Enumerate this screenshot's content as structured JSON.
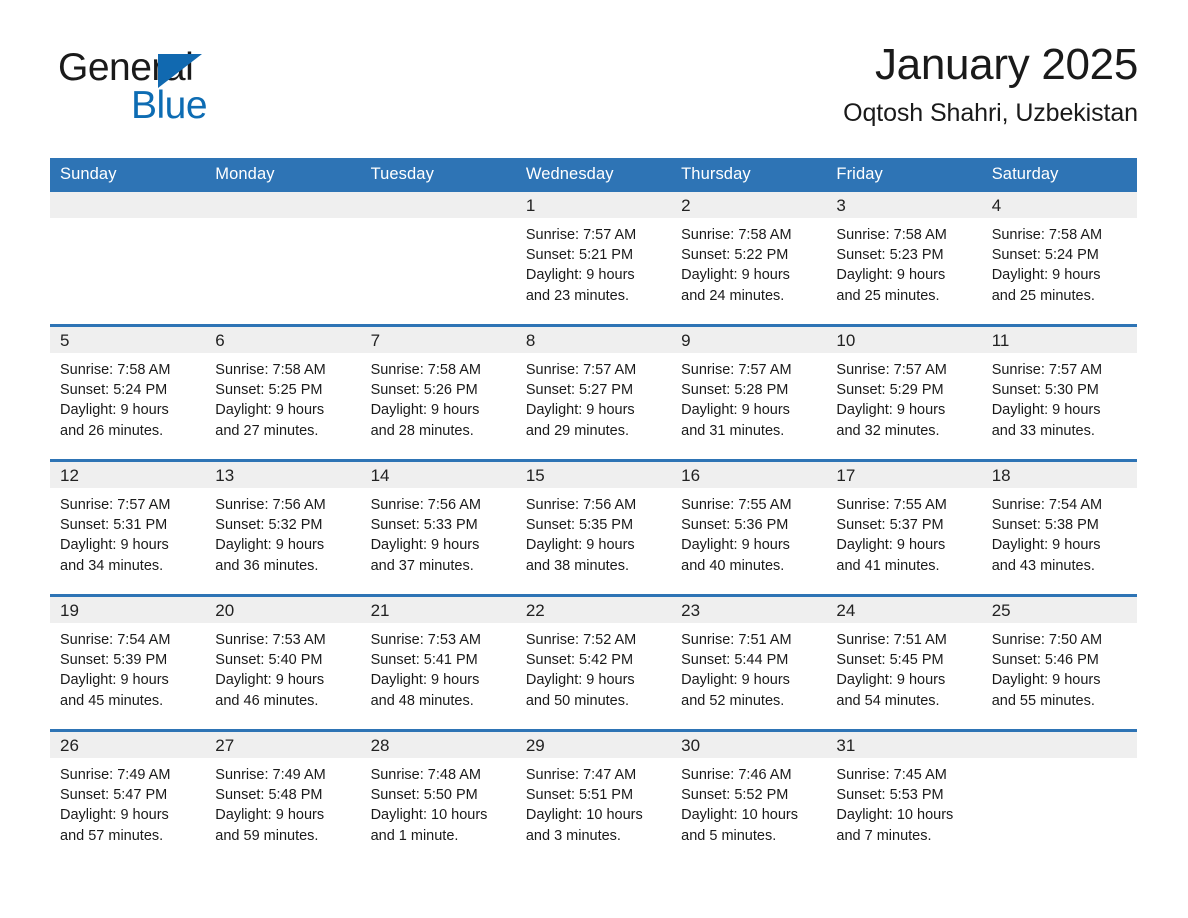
{
  "brand": {
    "name_part1": "General",
    "name_part2": "Blue",
    "triangle_color": "#1169b0",
    "blue_color": "#0d6cb3"
  },
  "header": {
    "title": "January 2025",
    "subtitle": "Oqtosh Shahri, Uzbekistan"
  },
  "theme": {
    "header_blue": "#2e74b5",
    "daynum_band_gray": "#efefef",
    "text_color": "#1a1a1a"
  },
  "weekdays": [
    "Sunday",
    "Monday",
    "Tuesday",
    "Wednesday",
    "Thursday",
    "Friday",
    "Saturday"
  ],
  "weeks": [
    [
      {
        "day": "",
        "blank": true,
        "sunrise": "",
        "sunset": "",
        "daylight_1": "",
        "daylight_2": ""
      },
      {
        "day": "",
        "blank": true,
        "sunrise": "",
        "sunset": "",
        "daylight_1": "",
        "daylight_2": ""
      },
      {
        "day": "",
        "blank": true,
        "sunrise": "",
        "sunset": "",
        "daylight_1": "",
        "daylight_2": ""
      },
      {
        "day": "1",
        "sunrise": "Sunrise: 7:57 AM",
        "sunset": "Sunset: 5:21 PM",
        "daylight_1": "Daylight: 9 hours",
        "daylight_2": "and 23 minutes."
      },
      {
        "day": "2",
        "sunrise": "Sunrise: 7:58 AM",
        "sunset": "Sunset: 5:22 PM",
        "daylight_1": "Daylight: 9 hours",
        "daylight_2": "and 24 minutes."
      },
      {
        "day": "3",
        "sunrise": "Sunrise: 7:58 AM",
        "sunset": "Sunset: 5:23 PM",
        "daylight_1": "Daylight: 9 hours",
        "daylight_2": "and 25 minutes."
      },
      {
        "day": "4",
        "sunrise": "Sunrise: 7:58 AM",
        "sunset": "Sunset: 5:24 PM",
        "daylight_1": "Daylight: 9 hours",
        "daylight_2": "and 25 minutes."
      }
    ],
    [
      {
        "day": "5",
        "sunrise": "Sunrise: 7:58 AM",
        "sunset": "Sunset: 5:24 PM",
        "daylight_1": "Daylight: 9 hours",
        "daylight_2": "and 26 minutes."
      },
      {
        "day": "6",
        "sunrise": "Sunrise: 7:58 AM",
        "sunset": "Sunset: 5:25 PM",
        "daylight_1": "Daylight: 9 hours",
        "daylight_2": "and 27 minutes."
      },
      {
        "day": "7",
        "sunrise": "Sunrise: 7:58 AM",
        "sunset": "Sunset: 5:26 PM",
        "daylight_1": "Daylight: 9 hours",
        "daylight_2": "and 28 minutes."
      },
      {
        "day": "8",
        "sunrise": "Sunrise: 7:57 AM",
        "sunset": "Sunset: 5:27 PM",
        "daylight_1": "Daylight: 9 hours",
        "daylight_2": "and 29 minutes."
      },
      {
        "day": "9",
        "sunrise": "Sunrise: 7:57 AM",
        "sunset": "Sunset: 5:28 PM",
        "daylight_1": "Daylight: 9 hours",
        "daylight_2": "and 31 minutes."
      },
      {
        "day": "10",
        "sunrise": "Sunrise: 7:57 AM",
        "sunset": "Sunset: 5:29 PM",
        "daylight_1": "Daylight: 9 hours",
        "daylight_2": "and 32 minutes."
      },
      {
        "day": "11",
        "sunrise": "Sunrise: 7:57 AM",
        "sunset": "Sunset: 5:30 PM",
        "daylight_1": "Daylight: 9 hours",
        "daylight_2": "and 33 minutes."
      }
    ],
    [
      {
        "day": "12",
        "sunrise": "Sunrise: 7:57 AM",
        "sunset": "Sunset: 5:31 PM",
        "daylight_1": "Daylight: 9 hours",
        "daylight_2": "and 34 minutes."
      },
      {
        "day": "13",
        "sunrise": "Sunrise: 7:56 AM",
        "sunset": "Sunset: 5:32 PM",
        "daylight_1": "Daylight: 9 hours",
        "daylight_2": "and 36 minutes."
      },
      {
        "day": "14",
        "sunrise": "Sunrise: 7:56 AM",
        "sunset": "Sunset: 5:33 PM",
        "daylight_1": "Daylight: 9 hours",
        "daylight_2": "and 37 minutes."
      },
      {
        "day": "15",
        "sunrise": "Sunrise: 7:56 AM",
        "sunset": "Sunset: 5:35 PM",
        "daylight_1": "Daylight: 9 hours",
        "daylight_2": "and 38 minutes."
      },
      {
        "day": "16",
        "sunrise": "Sunrise: 7:55 AM",
        "sunset": "Sunset: 5:36 PM",
        "daylight_1": "Daylight: 9 hours",
        "daylight_2": "and 40 minutes."
      },
      {
        "day": "17",
        "sunrise": "Sunrise: 7:55 AM",
        "sunset": "Sunset: 5:37 PM",
        "daylight_1": "Daylight: 9 hours",
        "daylight_2": "and 41 minutes."
      },
      {
        "day": "18",
        "sunrise": "Sunrise: 7:54 AM",
        "sunset": "Sunset: 5:38 PM",
        "daylight_1": "Daylight: 9 hours",
        "daylight_2": "and 43 minutes."
      }
    ],
    [
      {
        "day": "19",
        "sunrise": "Sunrise: 7:54 AM",
        "sunset": "Sunset: 5:39 PM",
        "daylight_1": "Daylight: 9 hours",
        "daylight_2": "and 45 minutes."
      },
      {
        "day": "20",
        "sunrise": "Sunrise: 7:53 AM",
        "sunset": "Sunset: 5:40 PM",
        "daylight_1": "Daylight: 9 hours",
        "daylight_2": "and 46 minutes."
      },
      {
        "day": "21",
        "sunrise": "Sunrise: 7:53 AM",
        "sunset": "Sunset: 5:41 PM",
        "daylight_1": "Daylight: 9 hours",
        "daylight_2": "and 48 minutes."
      },
      {
        "day": "22",
        "sunrise": "Sunrise: 7:52 AM",
        "sunset": "Sunset: 5:42 PM",
        "daylight_1": "Daylight: 9 hours",
        "daylight_2": "and 50 minutes."
      },
      {
        "day": "23",
        "sunrise": "Sunrise: 7:51 AM",
        "sunset": "Sunset: 5:44 PM",
        "daylight_1": "Daylight: 9 hours",
        "daylight_2": "and 52 minutes."
      },
      {
        "day": "24",
        "sunrise": "Sunrise: 7:51 AM",
        "sunset": "Sunset: 5:45 PM",
        "daylight_1": "Daylight: 9 hours",
        "daylight_2": "and 54 minutes."
      },
      {
        "day": "25",
        "sunrise": "Sunrise: 7:50 AM",
        "sunset": "Sunset: 5:46 PM",
        "daylight_1": "Daylight: 9 hours",
        "daylight_2": "and 55 minutes."
      }
    ],
    [
      {
        "day": "26",
        "sunrise": "Sunrise: 7:49 AM",
        "sunset": "Sunset: 5:47 PM",
        "daylight_1": "Daylight: 9 hours",
        "daylight_2": "and 57 minutes."
      },
      {
        "day": "27",
        "sunrise": "Sunrise: 7:49 AM",
        "sunset": "Sunset: 5:48 PM",
        "daylight_1": "Daylight: 9 hours",
        "daylight_2": "and 59 minutes."
      },
      {
        "day": "28",
        "sunrise": "Sunrise: 7:48 AM",
        "sunset": "Sunset: 5:50 PM",
        "daylight_1": "Daylight: 10 hours",
        "daylight_2": "and 1 minute."
      },
      {
        "day": "29",
        "sunrise": "Sunrise: 7:47 AM",
        "sunset": "Sunset: 5:51 PM",
        "daylight_1": "Daylight: 10 hours",
        "daylight_2": "and 3 minutes."
      },
      {
        "day": "30",
        "sunrise": "Sunrise: 7:46 AM",
        "sunset": "Sunset: 5:52 PM",
        "daylight_1": "Daylight: 10 hours",
        "daylight_2": "and 5 minutes."
      },
      {
        "day": "31",
        "sunrise": "Sunrise: 7:45 AM",
        "sunset": "Sunset: 5:53 PM",
        "daylight_1": "Daylight: 10 hours",
        "daylight_2": "and 7 minutes."
      },
      {
        "day": "",
        "blank": true,
        "sunrise": "",
        "sunset": "",
        "daylight_1": "",
        "daylight_2": ""
      }
    ]
  ]
}
